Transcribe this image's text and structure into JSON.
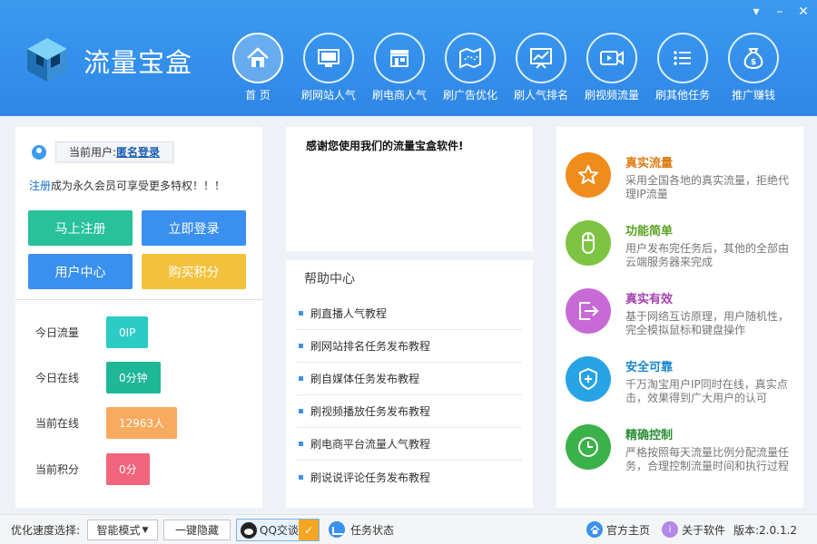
{
  "app_title": "流量宝盒",
  "window_controls": {
    "minimize": "▾",
    "restore": "–",
    "close": "✕"
  },
  "nav": [
    {
      "label": "首  页",
      "icon": "home-icon"
    },
    {
      "label": "刷网站人气",
      "icon": "monitor-icon"
    },
    {
      "label": "刷电商人气",
      "icon": "store-icon"
    },
    {
      "label": "刷广告优化",
      "icon": "map-icon"
    },
    {
      "label": "刷人气排名",
      "icon": "chart-icon"
    },
    {
      "label": "刷视频流量",
      "icon": "video-icon"
    },
    {
      "label": "刷其他任务",
      "icon": "list-icon"
    },
    {
      "label": "推广赚钱",
      "icon": "money-bag-icon"
    }
  ],
  "user": {
    "current_label": "当前用户:",
    "login_link": "匿名登录",
    "promo_register": "注册",
    "promo_text": "成为永久会员可享受更多特权！！！"
  },
  "buttons": {
    "register": "马上注册",
    "login": "立即登录",
    "user_center": "用户中心",
    "buy_points": "购买积分"
  },
  "stats": [
    {
      "label": "今日流量",
      "value": "0IP",
      "color": "#2ccbc6"
    },
    {
      "label": "今日在线",
      "value": "0分钟",
      "color": "#1eb797"
    },
    {
      "label": "当前在线",
      "value": "12963人",
      "color": "#f8aa5e"
    },
    {
      "label": "当前积分",
      "value": "0分",
      "color": "#f0647c"
    }
  ],
  "welcome": "感谢您使用我们的流量宝盒软件!",
  "help": {
    "title": "帮助中心",
    "items": [
      "刷直播人气教程",
      "刷网站排名任务发布教程",
      "刷自媒体任务发布教程",
      "刷视频播放任务发布教程",
      "刷电商平台流量人气教程",
      "刷说说评论任务发布教程"
    ]
  },
  "features": [
    {
      "title": "真实流量",
      "desc": "采用全国各地的真实流量，拒绝代理IP流量",
      "color": "#f08c1c",
      "title_color": "#e07a10",
      "icon": "star-icon"
    },
    {
      "title": "功能简单",
      "desc": "用户发布完任务后，其他的全部由云端服务器来完成",
      "color": "#7ec443",
      "title_color": "#5aa324",
      "icon": "mouse-icon"
    },
    {
      "title": "真实有效",
      "desc": "基于网络互访原理，用户随机性，完全模拟鼠标和键盘操作",
      "color": "#c86ad6",
      "title_color": "#a542b5",
      "icon": "exit-icon"
    },
    {
      "title": "安全可靠",
      "desc": "千万淘宝用户IP同时在线，真实点击，效果得到广大用户的认可",
      "color": "#27a3e6",
      "title_color": "#1a86cc",
      "icon": "shield-icon"
    },
    {
      "title": "精确控制",
      "desc": "严格按照每天流量比例分配流量任务，合理控制流量时间和执行过程",
      "color": "#3bb14a",
      "title_color": "#2a8f37",
      "icon": "clock-icon"
    }
  ],
  "bottom": {
    "speed_label": "优化速度选择:",
    "mode": "智能模式",
    "hide": "一键隐藏",
    "qq": "QQ交谈",
    "task_status": "任务状态",
    "home": "官方主页",
    "about": "关于软件",
    "version": "版本:2.0.1.2"
  }
}
